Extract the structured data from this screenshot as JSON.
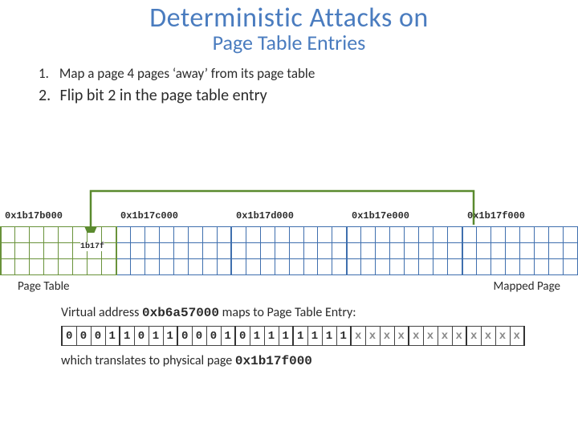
{
  "title": {
    "main": "Deterministic Attacks on",
    "sub": "Page Table Entries"
  },
  "steps": {
    "s1_num": "1.",
    "s1_text": "Map a page 4 pages ‘away’ from its page table",
    "s2_num": "2.",
    "s2_text": "Flip bit 2 in the page table entry"
  },
  "addresses": {
    "a0": "0x1b17b000",
    "a1": "0x1b17c000",
    "a2": "0x1b17d000",
    "a3": "0x1b17e000",
    "a4": "0x1b17f000"
  },
  "pte_cell_label": "1b17f",
  "captions": {
    "left": "Page Table",
    "right": "Mapped Page"
  },
  "vaddr": {
    "prefix": "Virtual address ",
    "addr": "0xb6a57000",
    "suffix": " maps to Page Table Entry:"
  },
  "bits": {
    "g0": [
      "0",
      "0",
      "0",
      "1"
    ],
    "g1": [
      "1",
      "0",
      "1",
      "1"
    ],
    "g2": [
      "0",
      "0",
      "0",
      "1"
    ],
    "g3": [
      "0",
      "1",
      "1",
      "1"
    ],
    "g4": [
      "1",
      "1",
      "1",
      "1"
    ],
    "g5": [
      "x",
      "x",
      "x",
      "x"
    ],
    "g6": [
      "x",
      "x",
      "x",
      "x"
    ],
    "g7": [
      "x",
      "x",
      "x",
      "x"
    ]
  },
  "translate": {
    "prefix": "which translates to physical page ",
    "addr": "0x1b17f000"
  }
}
